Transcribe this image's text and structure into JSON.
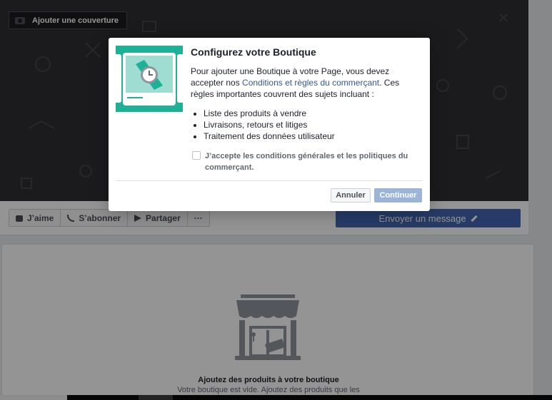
{
  "cover": {
    "add_cover_label": "Ajouter une couverture"
  },
  "actions": {
    "like_label": "J’aime",
    "subscribe_label": "S’abonner",
    "share_label": "Partager",
    "more_label": "···",
    "message_label": "Envoyer un message"
  },
  "shop": {
    "title": "Ajoutez des produits à votre boutique",
    "subtitle": "Votre boutique est vide. Ajoutez des produits que les"
  },
  "dialog": {
    "title": "Configurez votre Boutique",
    "body_prefix": "Pour ajouter une Boutique à votre Page, vous devez accepter nos ",
    "body_link": "Conditions et règles du commerçant",
    "body_suffix": ". Ces règles importantes couvrent des sujets incluant :",
    "list": [
      "Liste des produits à vendre",
      "Livraisons, retours et litiges",
      "Traitement des données utilisateur"
    ],
    "checkbox_label": "J’accepte les conditions générales et les politiques du commerçant.",
    "cancel_label": "Annuler",
    "continue_label": "Continuer"
  },
  "colors": {
    "primary": "#4267b2",
    "link": "#365899",
    "teal": "#1fb197",
    "disabled_button": "#9cb4d8"
  }
}
